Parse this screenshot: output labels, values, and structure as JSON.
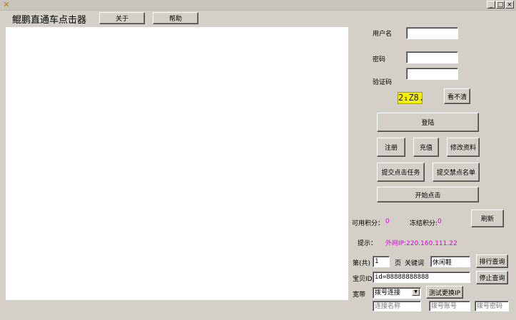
{
  "window": {
    "minimize": "_",
    "maximize": "□",
    "close": "×"
  },
  "app": {
    "title": "鲲鹏直通车点击器"
  },
  "menu": {
    "about": "关于",
    "help": "帮助"
  },
  "login": {
    "username_label": "用户名",
    "username_value": "",
    "password_label": "密码",
    "password_value": "",
    "captcha_label": "验证码",
    "captcha_value": "",
    "captcha_image_text": "2₁Z8.",
    "refresh_captcha_button": "看不清",
    "login_button": "登陆",
    "register_button": "注册",
    "recharge_button": "充值",
    "edit_profile_button": "修改资料",
    "submit_click_task_button": "提交点击任务",
    "submit_blocklist_button": "提交禁点名单",
    "start_click_button": "开始点击"
  },
  "points": {
    "available_label": "可用积分：",
    "available_value": "0",
    "frozen_label": "冻结积分:",
    "frozen_value": "0",
    "refresh_button": "刷新"
  },
  "hint": {
    "label": "提示：",
    "value": "外网IP:220.160.111.22"
  },
  "query": {
    "page_prefix": "第(共)",
    "page_value": "1",
    "page_suffix": "页",
    "keyword_label": "关键词",
    "keyword_value": "休闲鞋",
    "rank_query_button": "排行查询",
    "item_id_label": "宝贝ID",
    "item_id_value": "id=88888888888",
    "stop_query_button": "停止查询"
  },
  "broadband": {
    "label": "宽带",
    "select_value": "拨号连接",
    "test_ip_button": "测试更换IP",
    "connection_name_placeholder": "连接名称",
    "dial_account_placeholder": "拨号账号",
    "dial_password_placeholder": "拨号密码"
  }
}
